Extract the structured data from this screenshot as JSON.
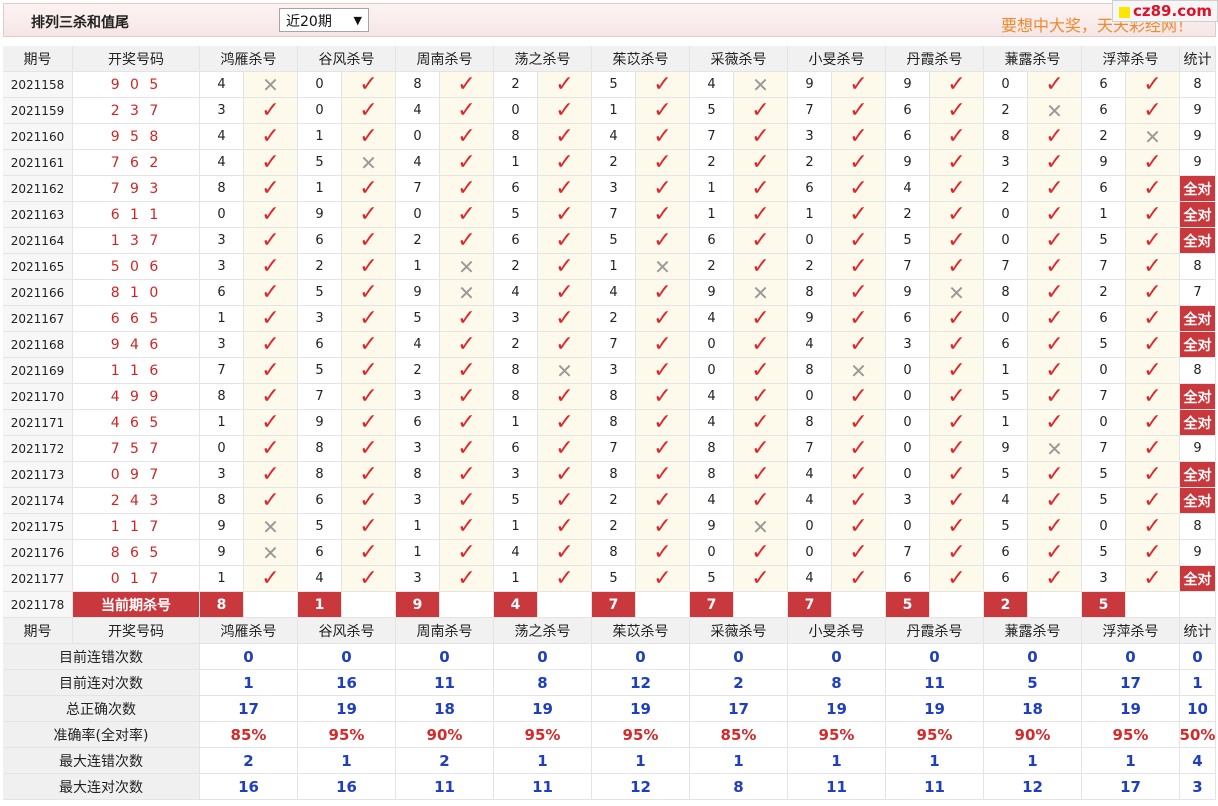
{
  "header": {
    "title": "排列三杀和值尾",
    "select_value": "近20期",
    "slogan": "要想中大奖，天天彩经网！",
    "site_badge": "cz89.com"
  },
  "columns": {
    "period": "期号",
    "number": "开奖号码",
    "experts": [
      "鸿雁杀号",
      "谷风杀号",
      "周南杀号",
      "荡之杀号",
      "茱苡杀号",
      "采薇杀号",
      "小旻杀号",
      "丹霞杀号",
      "蒹露杀号",
      "浮萍杀号"
    ],
    "stats": "统计"
  },
  "rows": [
    {
      "period": "2021158",
      "number": "9 0 5",
      "kills": [
        "4",
        "0",
        "8",
        "2",
        "5",
        "4",
        "9",
        "9",
        "0",
        "6"
      ],
      "marks": [
        "x",
        "ok",
        "ok",
        "ok",
        "ok",
        "x",
        "ok",
        "ok",
        "ok",
        "ok"
      ],
      "stat": "8"
    },
    {
      "period": "2021159",
      "number": "2 3 7",
      "kills": [
        "3",
        "0",
        "4",
        "0",
        "1",
        "5",
        "7",
        "6",
        "2",
        "6"
      ],
      "marks": [
        "ok",
        "ok",
        "ok",
        "ok",
        "ok",
        "ok",
        "ok",
        "ok",
        "x",
        "ok"
      ],
      "stat": "9"
    },
    {
      "period": "2021160",
      "number": "9 5 8",
      "kills": [
        "4",
        "1",
        "0",
        "8",
        "4",
        "7",
        "3",
        "6",
        "8",
        "2"
      ],
      "marks": [
        "ok",
        "ok",
        "ok",
        "ok",
        "ok",
        "ok",
        "ok",
        "ok",
        "ok",
        "x"
      ],
      "stat": "9"
    },
    {
      "period": "2021161",
      "number": "7 6 2",
      "kills": [
        "4",
        "5",
        "4",
        "1",
        "2",
        "2",
        "2",
        "9",
        "3",
        "9"
      ],
      "marks": [
        "ok",
        "x",
        "ok",
        "ok",
        "ok",
        "ok",
        "ok",
        "ok",
        "ok",
        "ok"
      ],
      "stat": "9"
    },
    {
      "period": "2021162",
      "number": "7 9 3",
      "kills": [
        "8",
        "1",
        "7",
        "6",
        "3",
        "1",
        "6",
        "4",
        "2",
        "6"
      ],
      "marks": [
        "ok",
        "ok",
        "ok",
        "ok",
        "ok",
        "ok",
        "ok",
        "ok",
        "ok",
        "ok"
      ],
      "stat": "全对"
    },
    {
      "period": "2021163",
      "number": "6 1 1",
      "kills": [
        "0",
        "9",
        "0",
        "5",
        "7",
        "1",
        "1",
        "2",
        "0",
        "1"
      ],
      "marks": [
        "ok",
        "ok",
        "ok",
        "ok",
        "ok",
        "ok",
        "ok",
        "ok",
        "ok",
        "ok"
      ],
      "stat": "全对"
    },
    {
      "period": "2021164",
      "number": "1 3 7",
      "kills": [
        "3",
        "6",
        "2",
        "6",
        "5",
        "6",
        "0",
        "5",
        "0",
        "5"
      ],
      "marks": [
        "ok",
        "ok",
        "ok",
        "ok",
        "ok",
        "ok",
        "ok",
        "ok",
        "ok",
        "ok"
      ],
      "stat": "全对"
    },
    {
      "period": "2021165",
      "number": "5 0 6",
      "kills": [
        "3",
        "2",
        "1",
        "2",
        "1",
        "2",
        "2",
        "7",
        "7",
        "7"
      ],
      "marks": [
        "ok",
        "ok",
        "x",
        "ok",
        "x",
        "ok",
        "ok",
        "ok",
        "ok",
        "ok"
      ],
      "stat": "8"
    },
    {
      "period": "2021166",
      "number": "8 1 0",
      "kills": [
        "6",
        "5",
        "9",
        "4",
        "4",
        "9",
        "8",
        "9",
        "8",
        "2"
      ],
      "marks": [
        "ok",
        "ok",
        "x",
        "ok",
        "ok",
        "x",
        "ok",
        "x",
        "ok",
        "ok"
      ],
      "stat": "7"
    },
    {
      "period": "2021167",
      "number": "6 6 5",
      "kills": [
        "1",
        "3",
        "5",
        "3",
        "2",
        "4",
        "9",
        "6",
        "0",
        "6"
      ],
      "marks": [
        "ok",
        "ok",
        "ok",
        "ok",
        "ok",
        "ok",
        "ok",
        "ok",
        "ok",
        "ok"
      ],
      "stat": "全对"
    },
    {
      "period": "2021168",
      "number": "9 4 6",
      "kills": [
        "3",
        "6",
        "4",
        "2",
        "7",
        "0",
        "4",
        "3",
        "6",
        "5"
      ],
      "marks": [
        "ok",
        "ok",
        "ok",
        "ok",
        "ok",
        "ok",
        "ok",
        "ok",
        "ok",
        "ok"
      ],
      "stat": "全对"
    },
    {
      "period": "2021169",
      "number": "1 1 6",
      "kills": [
        "7",
        "5",
        "2",
        "8",
        "3",
        "0",
        "8",
        "0",
        "1",
        "0"
      ],
      "marks": [
        "ok",
        "ok",
        "ok",
        "x",
        "ok",
        "ok",
        "x",
        "ok",
        "ok",
        "ok"
      ],
      "stat": "8"
    },
    {
      "period": "2021170",
      "number": "4 9 9",
      "kills": [
        "8",
        "7",
        "3",
        "8",
        "8",
        "4",
        "0",
        "0",
        "5",
        "7"
      ],
      "marks": [
        "ok",
        "ok",
        "ok",
        "ok",
        "ok",
        "ok",
        "ok",
        "ok",
        "ok",
        "ok"
      ],
      "stat": "全对"
    },
    {
      "period": "2021171",
      "number": "4 6 5",
      "kills": [
        "1",
        "9",
        "6",
        "1",
        "8",
        "4",
        "8",
        "0",
        "1",
        "0"
      ],
      "marks": [
        "ok",
        "ok",
        "ok",
        "ok",
        "ok",
        "ok",
        "ok",
        "ok",
        "ok",
        "ok"
      ],
      "stat": "全对"
    },
    {
      "period": "2021172",
      "number": "7 5 7",
      "kills": [
        "0",
        "8",
        "3",
        "6",
        "7",
        "8",
        "7",
        "0",
        "9",
        "7"
      ],
      "marks": [
        "ok",
        "ok",
        "ok",
        "ok",
        "ok",
        "ok",
        "ok",
        "ok",
        "x",
        "ok"
      ],
      "stat": "9"
    },
    {
      "period": "2021173",
      "number": "0 9 7",
      "kills": [
        "3",
        "8",
        "8",
        "3",
        "8",
        "8",
        "4",
        "0",
        "5",
        "5"
      ],
      "marks": [
        "ok",
        "ok",
        "ok",
        "ok",
        "ok",
        "ok",
        "ok",
        "ok",
        "ok",
        "ok"
      ],
      "stat": "全对"
    },
    {
      "period": "2021174",
      "number": "2 4 3",
      "kills": [
        "8",
        "6",
        "3",
        "5",
        "2",
        "4",
        "4",
        "3",
        "4",
        "5"
      ],
      "marks": [
        "ok",
        "ok",
        "ok",
        "ok",
        "ok",
        "ok",
        "ok",
        "ok",
        "ok",
        "ok"
      ],
      "stat": "全对"
    },
    {
      "period": "2021175",
      "number": "1 1 7",
      "kills": [
        "9",
        "5",
        "1",
        "1",
        "2",
        "9",
        "0",
        "0",
        "5",
        "0"
      ],
      "marks": [
        "x",
        "ok",
        "ok",
        "ok",
        "ok",
        "x",
        "ok",
        "ok",
        "ok",
        "ok"
      ],
      "stat": "8"
    },
    {
      "period": "2021176",
      "number": "8 6 5",
      "kills": [
        "9",
        "6",
        "1",
        "4",
        "8",
        "0",
        "0",
        "7",
        "6",
        "5"
      ],
      "marks": [
        "x",
        "ok",
        "ok",
        "ok",
        "ok",
        "ok",
        "ok",
        "ok",
        "ok",
        "ok"
      ],
      "stat": "9"
    },
    {
      "period": "2021177",
      "number": "0 1 7",
      "kills": [
        "1",
        "4",
        "3",
        "1",
        "5",
        "5",
        "4",
        "6",
        "6",
        "3"
      ],
      "marks": [
        "ok",
        "ok",
        "ok",
        "ok",
        "ok",
        "ok",
        "ok",
        "ok",
        "ok",
        "ok"
      ],
      "stat": "全对"
    }
  ],
  "current": {
    "period": "2021178",
    "label": "当前期杀号",
    "kills": [
      "8",
      "1",
      "9",
      "4",
      "7",
      "7",
      "7",
      "5",
      "2",
      "5"
    ]
  },
  "summary": [
    {
      "label": "目前连错次数",
      "values": [
        "0",
        "0",
        "0",
        "0",
        "0",
        "0",
        "0",
        "0",
        "0",
        "0"
      ],
      "stat": "0",
      "style": "num"
    },
    {
      "label": "目前连对次数",
      "values": [
        "1",
        "16",
        "11",
        "8",
        "12",
        "2",
        "8",
        "11",
        "5",
        "17"
      ],
      "stat": "1",
      "style": "num"
    },
    {
      "label": "总正确次数",
      "values": [
        "17",
        "19",
        "18",
        "19",
        "19",
        "17",
        "19",
        "19",
        "18",
        "19"
      ],
      "stat": "10",
      "style": "num"
    },
    {
      "label": "准确率(全对率)",
      "values": [
        "85%",
        "95%",
        "90%",
        "95%",
        "95%",
        "85%",
        "95%",
        "95%",
        "90%",
        "95%"
      ],
      "stat": "50%",
      "style": "pct"
    },
    {
      "label": "最大连错次数",
      "values": [
        "2",
        "1",
        "2",
        "1",
        "1",
        "1",
        "1",
        "1",
        "1",
        "1"
      ],
      "stat": "4",
      "style": "num"
    },
    {
      "label": "最大连对次数",
      "values": [
        "16",
        "16",
        "11",
        "11",
        "12",
        "8",
        "11",
        "11",
        "12",
        "17"
      ],
      "stat": "3",
      "style": "num"
    }
  ],
  "icons": {
    "ok": "check-icon",
    "x": "cross-icon"
  },
  "colors": {
    "accent_red": "#c8383c",
    "mark_red": "#e1252c",
    "stat_blue": "#1f3fbf",
    "slogan_orange": "#ee8a2e"
  }
}
